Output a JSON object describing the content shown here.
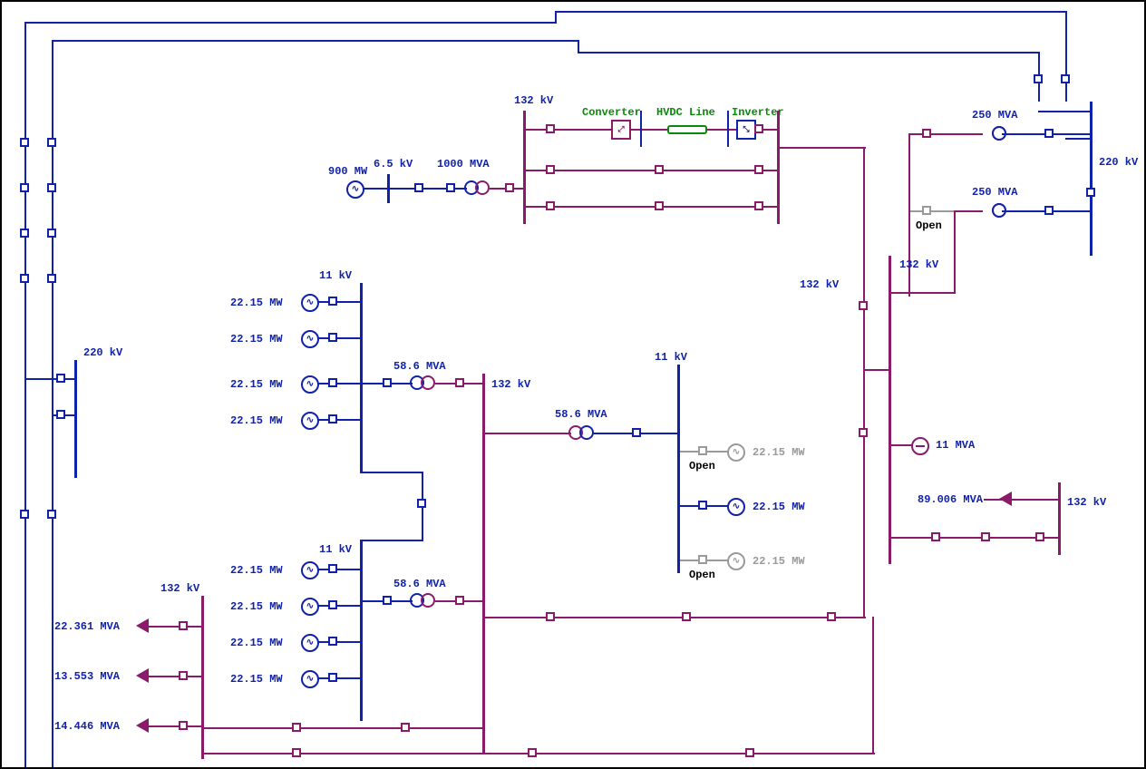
{
  "voltages": {
    "kv220_left": "220 kV",
    "kv220_right": "220 kV",
    "kv132_top": "132 kV",
    "kv132_mid": "132 kV",
    "kv132_right": "132 kV",
    "kv132_center": "132 kV",
    "kv132_lower_right": "132 kV",
    "kv132_left": "132 kV",
    "kv11_a": "11 kV",
    "kv11_b": "11 kV",
    "kv11_c": "11 kV",
    "kv6p5": "6.5 kV"
  },
  "gens": {
    "g900": "900 MW",
    "mw": "22.15 MW",
    "mw_grey": "22.15 MW"
  },
  "xfmrs": {
    "mva1000": "1000 MVA",
    "mva250": "250 MVA",
    "mva58": "58.6 MVA"
  },
  "loads": {
    "l1": "22.361 MVA",
    "l2": "13.553 MVA",
    "l3": "14.446 MVA",
    "l4": "89.006 MVA",
    "m1": "11 MVA"
  },
  "hvdc": {
    "converter": "Converter",
    "line": "HVDC Line",
    "inverter": "Inverter"
  },
  "open": "Open",
  "chart_data": {
    "type": "single-line-diagram",
    "buses": [
      {
        "name": "220kV-left",
        "kv": 220
      },
      {
        "name": "220kV-right",
        "kv": 220
      },
      {
        "name": "132kV-hvdc-send",
        "kv": 132
      },
      {
        "name": "132kV-hvdc-recv",
        "kv": 132
      },
      {
        "name": "132kV-center",
        "kv": 132
      },
      {
        "name": "132kV-lower-right",
        "kv": 132
      },
      {
        "name": "132kV-left-loads",
        "kv": 132
      },
      {
        "name": "11kV-genA",
        "kv": 11
      },
      {
        "name": "11kV-genB",
        "kv": 11
      },
      {
        "name": "11kV-genC",
        "kv": 11
      },
      {
        "name": "6.5kV-gen",
        "kv": 6.5
      }
    ],
    "generators": [
      {
        "bus": "6.5kV-gen",
        "mw": 900
      },
      {
        "bus": "11kV-genA",
        "mw": 22.15,
        "count": 4
      },
      {
        "bus": "11kV-genB",
        "mw": 22.15,
        "count": 4
      },
      {
        "bus": "11kV-genC",
        "mw": 22.15,
        "status": "open"
      },
      {
        "bus": "11kV-genC",
        "mw": 22.15,
        "status": "closed"
      },
      {
        "bus": "11kV-genC",
        "mw": 22.15,
        "status": "open"
      }
    ],
    "transformers": [
      {
        "mva": 1000,
        "from_kv": 6.5,
        "to_kv": 132
      },
      {
        "mva": 250,
        "from_kv": 132,
        "to_kv": 220
      },
      {
        "mva": 250,
        "from_kv": 132,
        "to_kv": 220
      },
      {
        "mva": 58.6,
        "from_kv": 11,
        "to_kv": 132
      },
      {
        "mva": 58.6,
        "from_kv": 11,
        "to_kv": 132
      },
      {
        "mva": 58.6,
        "from_kv": 11,
        "to_kv": 132
      }
    ],
    "loads": [
      {
        "bus": "132kV-left-loads",
        "mva": 22.361
      },
      {
        "bus": "132kV-left-loads",
        "mva": 13.553
      },
      {
        "bus": "132kV-left-loads",
        "mva": 14.446
      },
      {
        "bus": "132kV-lower-right",
        "mva": 89.006
      },
      {
        "bus": "132kV-recv",
        "mva": 11,
        "type": "motor"
      }
    ],
    "hvdc_link": {
      "converter": true,
      "inverter": true,
      "between": [
        "132kV-hvdc-send",
        "132kV-hvdc-recv"
      ]
    },
    "open_breakers": [
      "11kV-genC-g1",
      "11kV-genC-g3",
      "250MVA-xfmr-2-feed"
    ]
  }
}
